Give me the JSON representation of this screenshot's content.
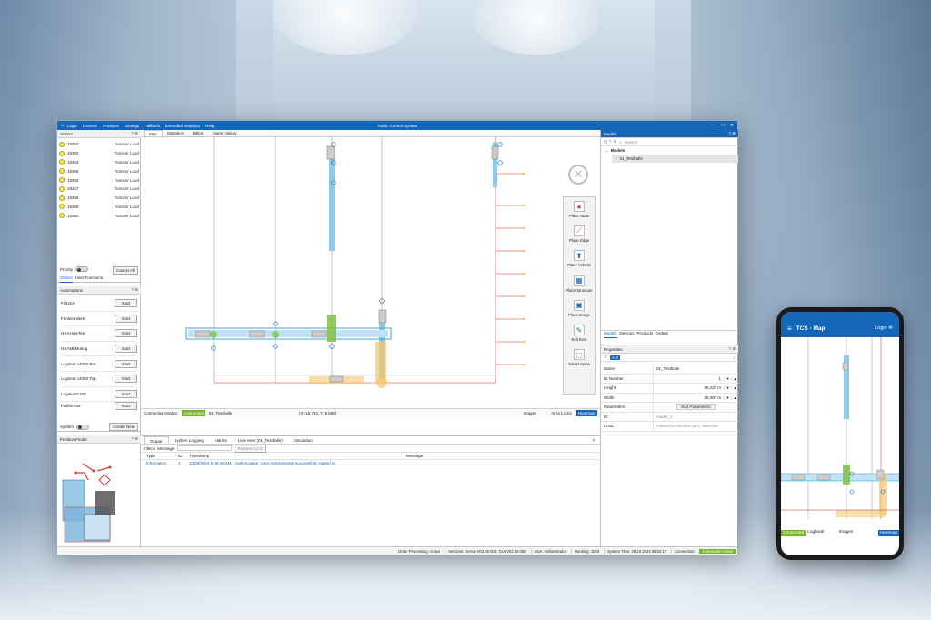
{
  "window": {
    "title": "Traffic Control System",
    "menu": [
      "Login",
      "Devices",
      "Products",
      "Settings",
      "Fallback",
      "Extended Statistics",
      "Help"
    ],
    "controls": [
      "—",
      "□",
      "✕"
    ]
  },
  "orders": {
    "title": "Orders",
    "header_icons": "? ⊕",
    "items": [
      {
        "id": "19352",
        "type": "Transfer Load"
      },
      {
        "id": "19353",
        "type": "Transfer Load"
      },
      {
        "id": "19354",
        "type": "Transfer Load"
      },
      {
        "id": "19355",
        "type": "Transfer Load"
      },
      {
        "id": "19356",
        "type": "Transfer Load"
      },
      {
        "id": "19357",
        "type": "Transfer Load"
      },
      {
        "id": "19358",
        "type": "Transfer Load"
      },
      {
        "id": "19359",
        "type": "Transfer Load"
      },
      {
        "id": "19360",
        "type": "Transfer Load"
      }
    ],
    "priority_label": "Priority",
    "cancel_all": "Cancel All",
    "subtabs": [
      "Orders",
      "User Functions"
    ]
  },
  "automations": {
    "title": "Automations",
    "header_icons": "? ⊕",
    "items": [
      {
        "name": "FillHSA",
        "button": "Start"
      },
      {
        "name": "Funktionstest",
        "button": "Start"
      },
      {
        "name": "HSAHoleTest",
        "button": "Start"
      },
      {
        "name": "HSAMitMuting",
        "button": "Start"
      },
      {
        "name": "Logimat c4060 Bot",
        "button": "Start"
      },
      {
        "name": "Logimat c4060 Top",
        "button": "Start"
      },
      {
        "name": "LogimatG150",
        "button": "Start"
      },
      {
        "name": "ProfileTest",
        "button": "Start"
      }
    ],
    "system_label": "System",
    "create_new": "Create New"
  },
  "position_finder": {
    "title": "Position Finder",
    "header_icons": "? ⊕"
  },
  "main_tabs": [
    "Map",
    "Statistics",
    "Editor",
    "Alarm History"
  ],
  "toolbox": [
    {
      "label": "Place Node",
      "icon": "●"
    },
    {
      "label": "Place Edge",
      "icon": "⟋"
    },
    {
      "label": "Place Vehicle",
      "icon": "⬆"
    },
    {
      "label": "Place Structure",
      "icon": "▦"
    },
    {
      "label": "Place Image",
      "icon": "▣"
    },
    {
      "label": "Edit Item",
      "icon": "✎"
    },
    {
      "label": "Select Items",
      "icon": "⬚"
    }
  ],
  "map_status": {
    "connection_label": "Connection Status:",
    "connection_value": "Connected",
    "model": "01_Testhalle",
    "coords": "(X: 16.764, Y: 8.598)",
    "images": "Images",
    "area_locks": "Area Locks",
    "heatmap": "Heatmap"
  },
  "output": {
    "tabs": [
      "Output",
      "System Logging",
      "Alarms",
      "Live-View (01_Testhalle)",
      "Simulation"
    ],
    "filters_label": "Filters",
    "message_label": "Message",
    "release_lock": "Release Lock",
    "columns": [
      "Type",
      "ID",
      "Timestamp",
      "Message"
    ],
    "rows": [
      {
        "type": "Information",
        "id": "1",
        "timestamp": "10/29/2024 6:48:49 AM",
        "message": "Authorization: User Administrator successfully signed in"
      }
    ]
  },
  "models": {
    "title": "Models",
    "header_icons": "? ⊕",
    "search_placeholder": "Search",
    "tree_root": "Models",
    "tree_child": "01_Testhalle",
    "tabs": [
      "Models",
      "Devices",
      "Products",
      "Orders"
    ]
  },
  "properties": {
    "title": "Properties",
    "header_icons": "? ⊕",
    "search_value": "A-Z",
    "rows": [
      {
        "key": "Name",
        "value": "01_Testhalle"
      },
      {
        "key": "ID Number",
        "value": "1"
      },
      {
        "key": "Height",
        "value": "40,220 m"
      },
      {
        "key": "Width",
        "value": "30,000 m"
      },
      {
        "key": "Parameters",
        "value": "Edit Parameters"
      },
      {
        "key": "ID",
        "value": "model_1"
      },
      {
        "key": "UUID",
        "value": "53e90403-c755-4591-a072-7ee0000b"
      }
    ]
  },
  "statusbar": [
    "Order Processing: Active",
    "Versions: Kernel V02.00.000, GUI V02.00.000",
    "User: Administrator",
    "Ranking: 1003",
    "System Time: 29.10.2024 08:52:17",
    "Connection:",
    "Connection Active"
  ],
  "phone": {
    "title": "TCS - Map",
    "login": "Login",
    "connected": "Connected",
    "logbook": "Logbook",
    "images": "Images",
    "heatmap": "Heatmap"
  },
  "colors": {
    "brand": "#1466b8",
    "connected": "#76b82a",
    "lane": "#8fcbe8",
    "green_node": "#7cc242",
    "orange_node": "#f5c76b"
  }
}
